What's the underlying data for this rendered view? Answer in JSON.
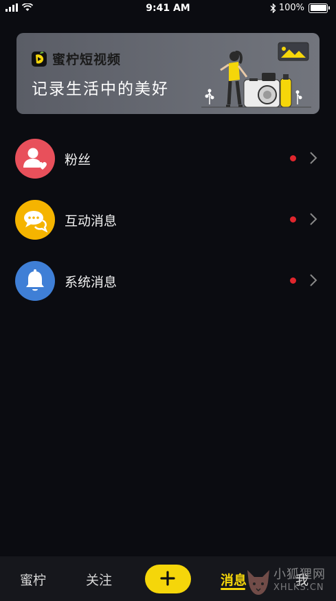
{
  "status_bar": {
    "time": "9:41 AM",
    "battery": "100%",
    "battery_level": 1.0
  },
  "banner": {
    "brand_name": "蜜柠短视频",
    "slogan": "记录生活中的美好"
  },
  "messages": [
    {
      "label": "粉丝",
      "icon": "fans-icon",
      "color": "#e8505b",
      "unread": true
    },
    {
      "label": "互动消息",
      "icon": "chat-bubbles-icon",
      "color": "#f5b400",
      "unread": true
    },
    {
      "label": "系统消息",
      "icon": "bell-icon",
      "color": "#3f7fd6",
      "unread": true
    }
  ],
  "tabbar": {
    "tabs": [
      "蜜柠",
      "关注",
      "消息",
      "我"
    ],
    "active": "消息",
    "add_icon": "plus-icon"
  },
  "colors": {
    "accent": "#f5d60a",
    "unread_dot": "#e0262d",
    "background": "#0b0c11"
  },
  "watermark": {
    "line1": "小狐狸网",
    "line2": "XHLKS.CN"
  }
}
